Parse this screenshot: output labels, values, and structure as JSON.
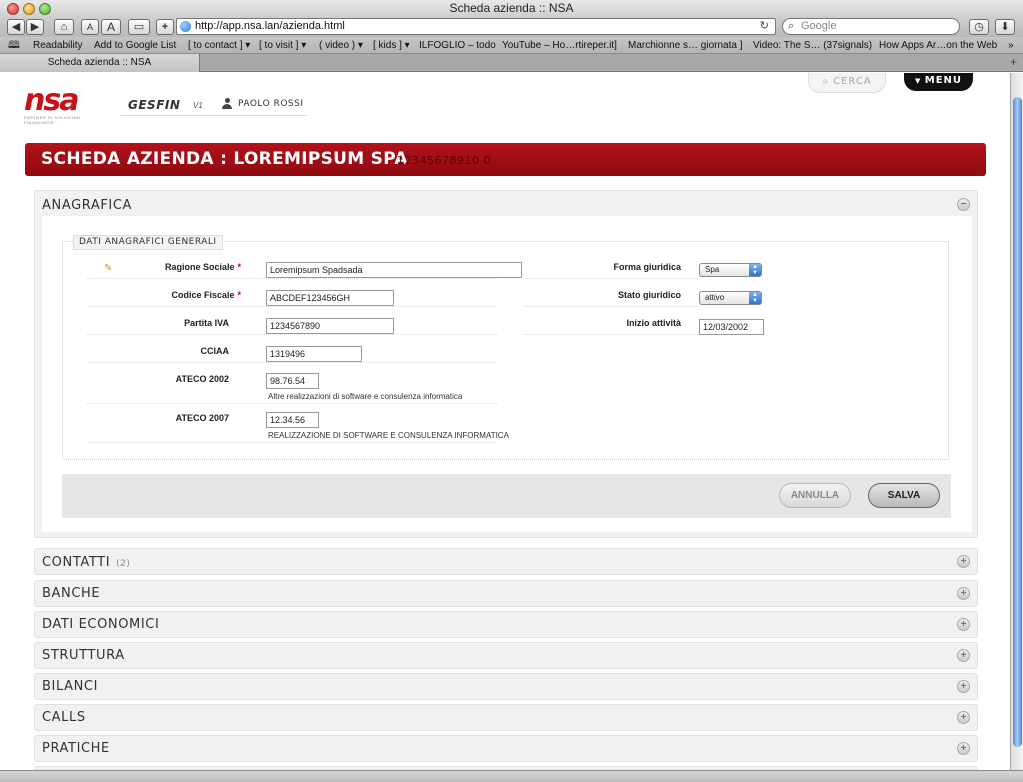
{
  "browser": {
    "window_title": "Scheda azienda :: NSA",
    "font_small_label": "A",
    "font_big_label": "A",
    "add_label": "+",
    "url": "http://app.nsa.lan/azienda.html",
    "reload_glyph": "↻",
    "search_placeholder": "Google",
    "bookmarks": [
      "Readability",
      "Add to Google List",
      "[ to contact ] ▾",
      "[ to visit ] ▾",
      "( video ) ▾",
      "[ kids ] ▾",
      "ILFOGLIO – todo",
      "YouTube – Ho…rtireper.it]",
      "Marchionne s… giornata ]",
      "Video: The S… (37signals)",
      "How Apps Ar…on the Web"
    ],
    "bookmarks_more": "»",
    "tab_title": "Scheda azienda :: NSA",
    "new_tab": "+"
  },
  "header": {
    "logo_text": "nsa",
    "logo_sub": "PARTNER DI SOLUZIONI FINANZIARIE",
    "app_name": "GESFIN",
    "app_version": "V1",
    "user_name": "PAOLO ROSSI",
    "search_label": "CERCA",
    "menu_label": "MENU"
  },
  "page": {
    "title": "SCHEDA AZIENDA : LOREMIPSUM SPA",
    "code": "12345678910 0"
  },
  "anagrafica": {
    "label": "ANAGRAFICA",
    "legend": "DATI ANAGRAFICI GENERALI",
    "fields": {
      "ragione_sociale": {
        "label": "Ragione Sociale",
        "value": "Loremipsum Spadsada",
        "required": "*"
      },
      "codice_fiscale": {
        "label": "Codice Fiscale",
        "value": "ABCDEF123456GH",
        "required": "*"
      },
      "partita_iva": {
        "label": "Partita IVA",
        "value": "1234567890"
      },
      "cciaa": {
        "label": "CCIAA",
        "value": "1319496"
      },
      "ateco_2002": {
        "label": "ATECO 2002",
        "value": "98.76.54",
        "help": "Altre realizzazioni di software e consulenza informatica"
      },
      "ateco_2007": {
        "label": "ATECO 2007",
        "value": "12.34.56",
        "help": "REALIZZAZIONE DI SOFTWARE E CONSULENZA INFORMATICA"
      },
      "forma_giuridica": {
        "label": "Forma giuridica",
        "value": "Spa"
      },
      "stato_giuridico": {
        "label": "Stato giuridico",
        "value": "attivo"
      },
      "inizio_attivita": {
        "label": "Inizio attività",
        "value": "12/03/2002"
      }
    },
    "cancel_label": "ANNULLA",
    "save_label": "SALVA"
  },
  "sections": [
    {
      "label": "CONTATTI",
      "count": "(2)"
    },
    {
      "label": "BANCHE",
      "count": ""
    },
    {
      "label": "DATI ECONOMICI",
      "count": ""
    },
    {
      "label": "STRUTTURA",
      "count": ""
    },
    {
      "label": "BILANCI",
      "count": ""
    },
    {
      "label": "CALLS",
      "count": ""
    },
    {
      "label": "PRATICHE",
      "count": ""
    }
  ],
  "colors": {
    "brand_red": "#a00d14",
    "accent_blue": "#2f72d4"
  }
}
